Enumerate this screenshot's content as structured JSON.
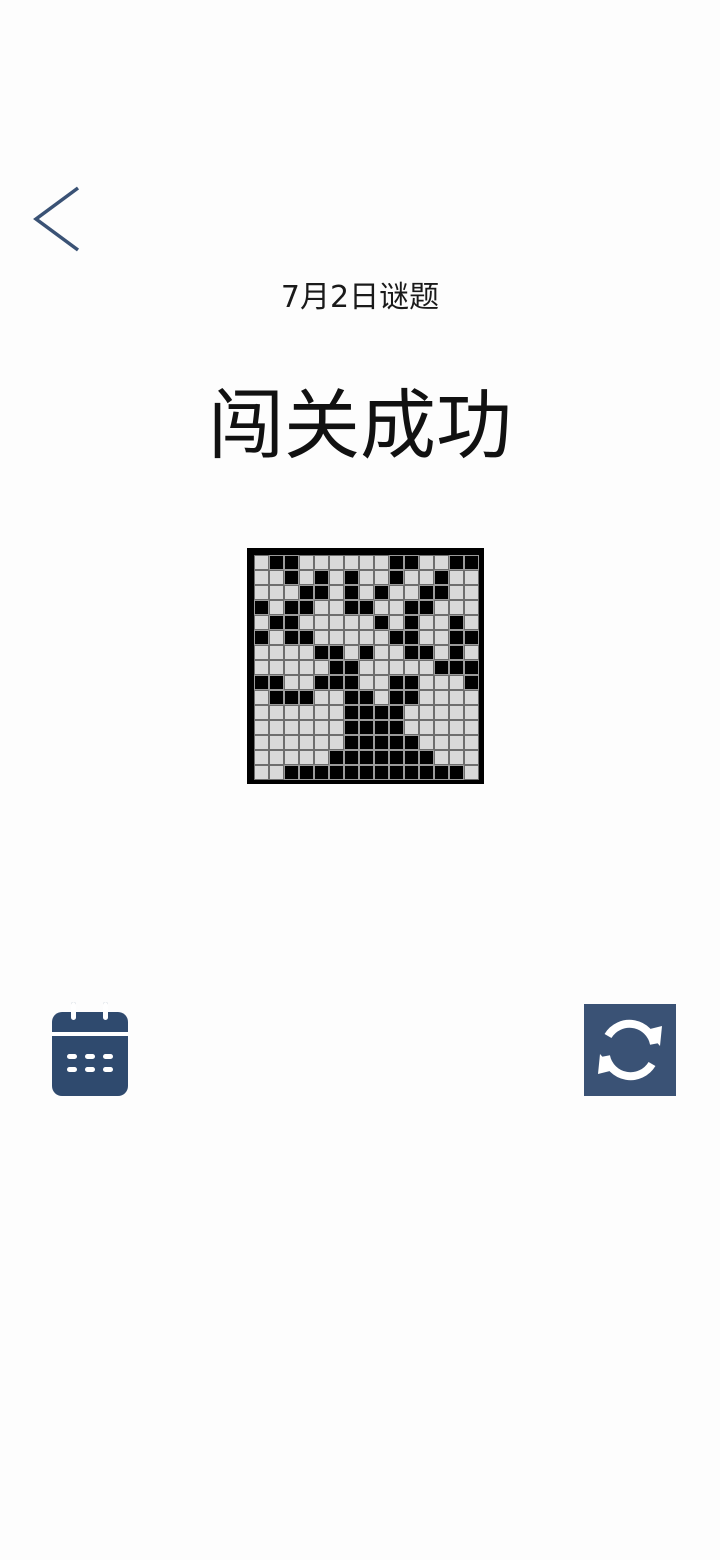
{
  "header": {
    "back_icon": "chevron-left-icon",
    "subtitle": "7月2日谜题"
  },
  "result": {
    "headline": "闯关成功"
  },
  "puzzle": {
    "size": 15,
    "rows": [
      "011000000110011",
      "001010100100100",
      "000110101001100",
      "101100110011000",
      "011000001010010",
      "101100000110011",
      "000011010011010",
      "000001100000111",
      "110011100110001",
      "011100110110000",
      "000000111100000",
      "000000111100000",
      "000000111110000",
      "000001111111000",
      "001111111111110"
    ],
    "colors": {
      "filled": "#000000",
      "empty": "#d9d9d9",
      "frame": "#000000"
    }
  },
  "actions": {
    "calendar_icon": "calendar-icon",
    "refresh_icon": "refresh-icon",
    "accent_color": "#3a5275"
  }
}
